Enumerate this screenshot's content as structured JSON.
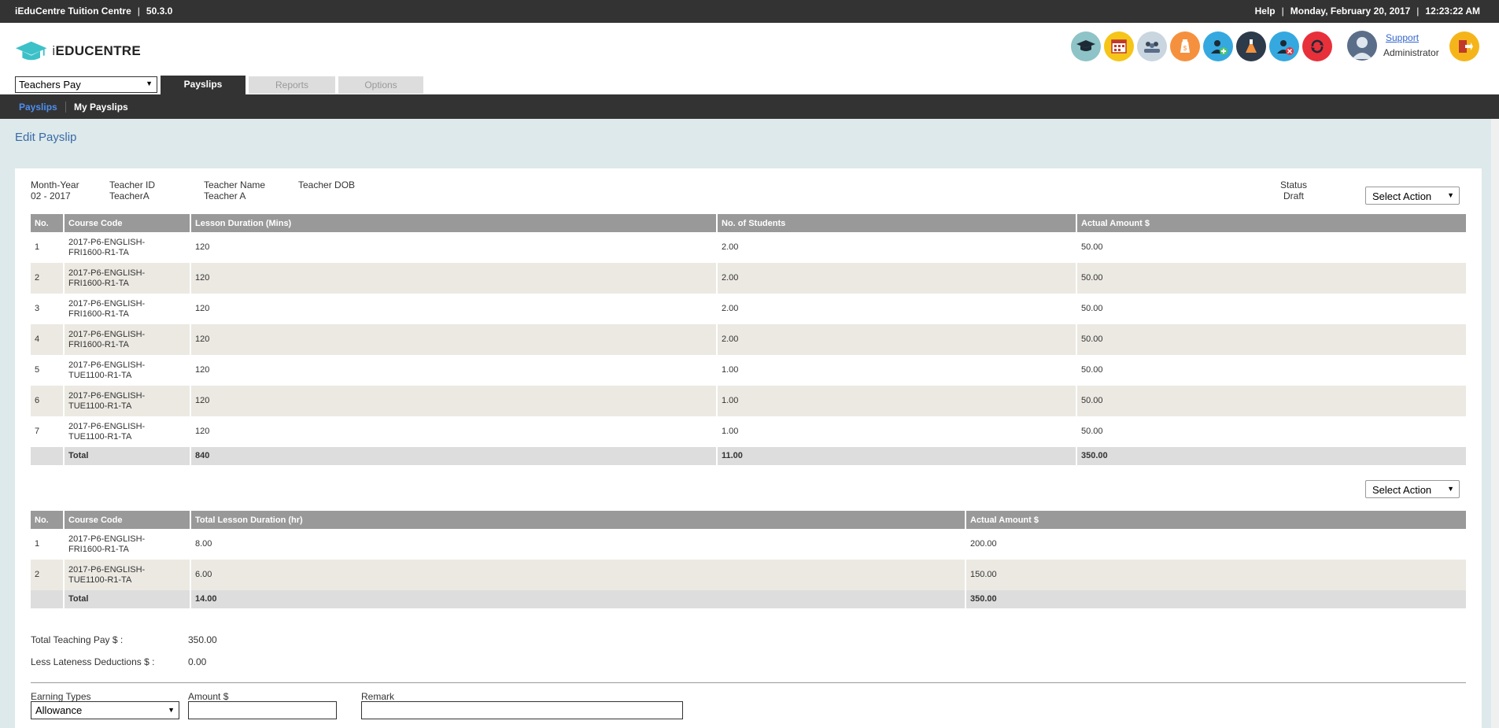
{
  "topbar": {
    "app_name": "iEduCentre Tuition Centre",
    "version": "50.3.0",
    "help": "Help",
    "date": "Monday, February 20, 2017",
    "time": "12:23:22 AM"
  },
  "logo": {
    "prefix": "i",
    "brand": "EDUCENTRE"
  },
  "header_icons": [
    {
      "name": "graduation-cap-icon",
      "color": "#8ec3c7"
    },
    {
      "name": "calendar-icon",
      "color": "#f5c518"
    },
    {
      "name": "group-icon",
      "color": "#c9d6e0"
    },
    {
      "name": "payment-bag-icon",
      "color": "#f5913e"
    },
    {
      "name": "add-teacher-icon",
      "color": "#35a8e0"
    },
    {
      "name": "lab-flask-icon",
      "color": "#2d3a4a"
    },
    {
      "name": "remove-user-icon",
      "color": "#35a8e0"
    },
    {
      "name": "sync-icon",
      "color": "#e8303a"
    }
  ],
  "user": {
    "support": "Support",
    "role": "Administrator"
  },
  "module_select": "Teachers Pay",
  "tabs": [
    "Payslips",
    "Reports",
    "Options"
  ],
  "subnav": [
    "Payslips",
    "My Payslips"
  ],
  "page_title": "Edit Payslip",
  "meta": {
    "month_year_label": "Month-Year",
    "month_year": "02 - 2017",
    "teacher_id_label": "Teacher ID",
    "teacher_id": "TeacherA",
    "teacher_name_label": "Teacher Name",
    "teacher_name": "Teacher A",
    "teacher_dob_label": "Teacher DOB",
    "status_label": "Status",
    "status": "Draft"
  },
  "select_action": "Select Action",
  "table1": {
    "headers": [
      "No.",
      "Course Code",
      "Lesson Duration (Mins)",
      "No. of Students",
      "Actual Amount $"
    ],
    "rows": [
      [
        "1",
        "2017-P6-ENGLISH-",
        "FRI1600-R1-TA",
        "120",
        "2.00",
        "50.00"
      ],
      [
        "2",
        "2017-P6-ENGLISH-",
        "FRI1600-R1-TA",
        "120",
        "2.00",
        "50.00"
      ],
      [
        "3",
        "2017-P6-ENGLISH-",
        "FRI1600-R1-TA",
        "120",
        "2.00",
        "50.00"
      ],
      [
        "4",
        "2017-P6-ENGLISH-",
        "FRI1600-R1-TA",
        "120",
        "2.00",
        "50.00"
      ],
      [
        "5",
        "2017-P6-ENGLISH-",
        "TUE1100-R1-TA",
        "120",
        "1.00",
        "50.00"
      ],
      [
        "6",
        "2017-P6-ENGLISH-",
        "TUE1100-R1-TA",
        "120",
        "1.00",
        "50.00"
      ],
      [
        "7",
        "2017-P6-ENGLISH-",
        "TUE1100-R1-TA",
        "120",
        "1.00",
        "50.00"
      ]
    ],
    "total": [
      "Total",
      "840",
      "11.00",
      "350.00"
    ]
  },
  "table2": {
    "headers": [
      "No.",
      "Course Code",
      "Total Lesson Duration (hr)",
      "Actual Amount $"
    ],
    "rows": [
      [
        "1",
        "2017-P6-ENGLISH-",
        "FRI1600-R1-TA",
        "8.00",
        "200.00"
      ],
      [
        "2",
        "2017-P6-ENGLISH-",
        "TUE1100-R1-TA",
        "6.00",
        "150.00"
      ]
    ],
    "total": [
      "Total",
      "14.00",
      "350.00"
    ]
  },
  "summary": {
    "teaching_pay_label": "Total Teaching Pay $ :",
    "teaching_pay": "350.00",
    "lateness_label": "Less Lateness Deductions $ :",
    "lateness": "0.00"
  },
  "earnings_form": {
    "earning_types_label": "Earning Types",
    "earning_type_value": "Allowance",
    "amount_label": "Amount $",
    "remark_label": "Remark"
  }
}
